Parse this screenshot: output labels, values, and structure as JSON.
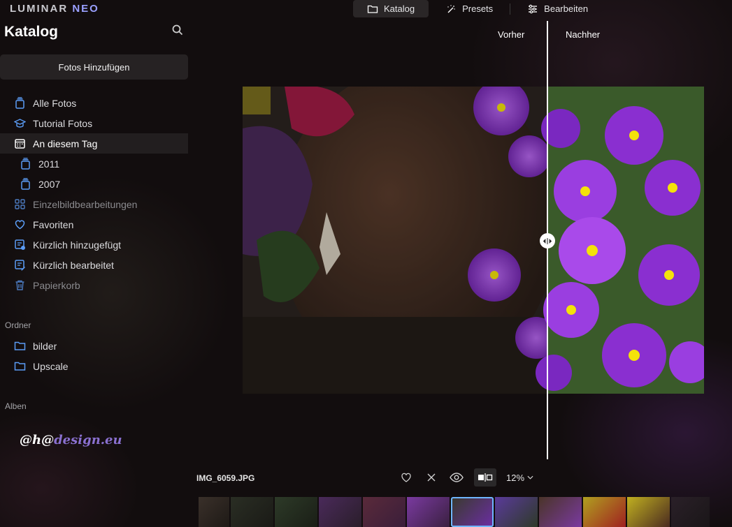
{
  "app": {
    "logo": "LUMINAR",
    "logo_accent": "NEO"
  },
  "topnav": {
    "tabs": [
      {
        "label": "Katalog",
        "icon": "folder-icon",
        "active": true
      },
      {
        "label": "Presets",
        "icon": "magic-wand-icon",
        "active": false
      },
      {
        "label": "Bearbeiten",
        "icon": "sliders-icon",
        "active": false
      }
    ]
  },
  "sidebar": {
    "title": "Katalog",
    "add_button": "Fotos Hinzufügen",
    "items": [
      {
        "label": "Alle Fotos",
        "icon": "photo-stack-icon"
      },
      {
        "label": "Tutorial Fotos",
        "icon": "graduation-cap-icon"
      },
      {
        "label": "An diesem Tag",
        "icon": "calendar-icon",
        "active": true
      },
      {
        "label": "2011",
        "icon": "photo-stack-icon"
      },
      {
        "label": "2007",
        "icon": "photo-stack-icon"
      },
      {
        "label": "Einzelbildbearbeitungen",
        "icon": "grid-icon",
        "dim": true
      },
      {
        "label": "Favoriten",
        "icon": "heart-icon"
      },
      {
        "label": "Kürzlich hinzugefügt",
        "icon": "recent-added-icon"
      },
      {
        "label": "Kürzlich bearbeitet",
        "icon": "recent-edited-icon"
      },
      {
        "label": "Papierkorb",
        "icon": "trash-icon",
        "dim": true
      }
    ],
    "folders_heading": "Ordner",
    "folders": [
      {
        "label": "bilder",
        "icon": "folder-icon"
      },
      {
        "label": "Upscale",
        "icon": "folder-icon"
      }
    ],
    "albums_heading": "Alben",
    "watermark_a": "@h@",
    "watermark_b": "design.eu"
  },
  "compare": {
    "before_label": "Vorher",
    "after_label": "Nachher"
  },
  "bottombar": {
    "filename": "IMG_6059.JPG",
    "zoom": "12%",
    "tools": [
      "heart-icon",
      "close-icon",
      "eye-icon",
      "compare-icon"
    ]
  },
  "colors": {
    "accent": "#5b9cf5",
    "selected_thumb": "#6fb6ff",
    "flower_purple": "#8a2fd0",
    "flower_yellow": "#f4e20a"
  }
}
